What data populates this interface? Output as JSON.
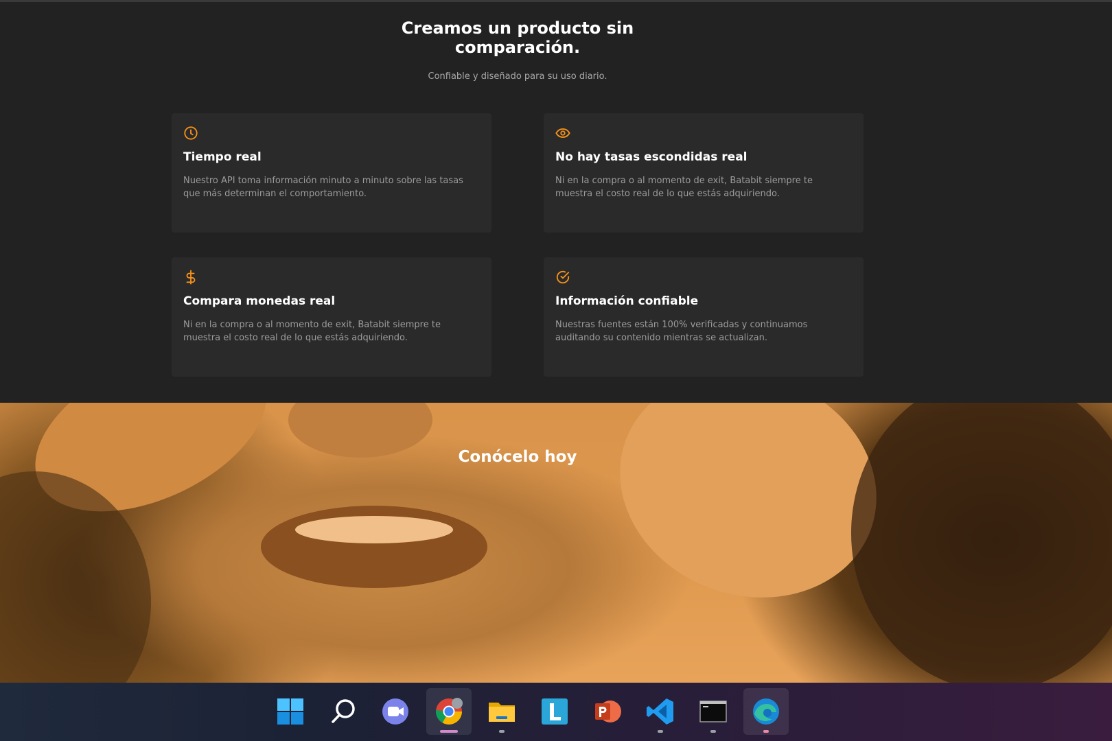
{
  "features": {
    "title_line1": "Creamos un producto sin",
    "title_line2": "comparación.",
    "subtitle": "Confiable y diseñado para su uso diario.",
    "cards": [
      {
        "icon": "clock-icon",
        "title": "Tiempo real",
        "text": "Nuestro API toma información minuto a minuto sobre las tasas que más determinan el comportamiento."
      },
      {
        "icon": "eye-icon",
        "title": "No hay tasas escondidas real",
        "text": "Ni en la compra o al momento de exit, Batabit siempre te muestra el costo real de lo que estás adquiriendo."
      },
      {
        "icon": "dollar-icon",
        "title": "Compara monedas real",
        "text": "Ni en la compra o al momento de exit, Batabit siempre te muestra el costo real de lo que estás adquiriendo."
      },
      {
        "icon": "check-circle-icon",
        "title": "Información confiable",
        "text": "Nuestras fuentes están 100% verificadas y continuamos auditando su contenido mientras se actualizan."
      }
    ],
    "accent_color": "#f7931a"
  },
  "hero": {
    "heading": "Conócelo hoy"
  },
  "taskbar": {
    "apps": [
      "windows-start-icon",
      "search-icon",
      "teams-chat-icon",
      "chrome-icon",
      "file-explorer-icon",
      "l-app-icon",
      "powerpoint-icon",
      "vscode-icon",
      "terminal-icon",
      "edge-icon"
    ]
  }
}
